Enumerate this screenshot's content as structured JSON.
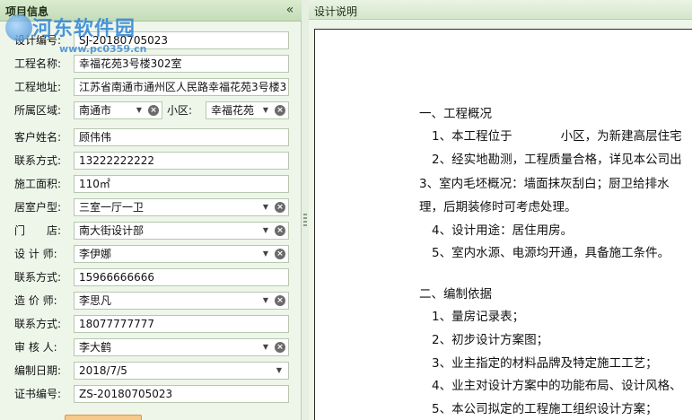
{
  "left_panel": {
    "title": "项目信息",
    "collapse_glyph": "«",
    "fields": [
      {
        "label": "设计编号:",
        "value": "SJ-20180705023",
        "type": "text"
      },
      {
        "label": "工程名称:",
        "value": "幸福花苑3号楼302室",
        "type": "text"
      },
      {
        "label": "工程地址:",
        "value": "江苏省南通市通州区人民路幸福花苑3号楼3",
        "type": "text"
      },
      {
        "label": "所属区域:",
        "value": "南通市",
        "type": "select"
      },
      {
        "label": "客户姓名:",
        "value": "顾伟伟",
        "type": "text"
      },
      {
        "label": "联系方式:",
        "value": "13222222222",
        "type": "text"
      },
      {
        "label": "施工面积:",
        "value": "110㎡",
        "type": "text"
      },
      {
        "label": "居室户型:",
        "value": "三室一厅一卫",
        "type": "select"
      },
      {
        "label": "门　　店:",
        "value": "南大街设计部",
        "type": "select"
      },
      {
        "label": "设 计 师:",
        "value": "李伊娜",
        "type": "select"
      },
      {
        "label": "联系方式:",
        "value": "15966666666",
        "type": "text"
      },
      {
        "label": "造 价 师:",
        "value": "李思凡",
        "type": "select"
      },
      {
        "label": "联系方式:",
        "value": "18077777777",
        "type": "text"
      },
      {
        "label": "审 核 人:",
        "value": "李大鹤",
        "type": "select"
      },
      {
        "label": "编制日期:",
        "value": "2018/7/5",
        "type": "date"
      },
      {
        "label": "证书编号:",
        "value": "ZS-20180705023",
        "type": "text"
      }
    ],
    "subarea_label": "小区:",
    "subarea_value": "幸福花苑"
  },
  "watermark": {
    "text": "河东软件园",
    "url": "www.pc0359.cn"
  },
  "right_panel": {
    "title": "设计说明",
    "doc_lines": [
      "一、工程概况",
      "1、本工程位于　　　　小区，为新建高层住宅",
      "2、经实地勘测，工程质量合格，详见本公司出",
      "3、室内毛坯概况：墙面抹灰刮白；厨卫给排水",
      "理，后期装修时可考虑处理。",
      "4、设计用途：居住用房。",
      "5、室内水源、电源均开通，具备施工条件。",
      "二、编制依据",
      "1、量房记录表；",
      "2、初步设计方案图；",
      "3、业主指定的材料品牌及特定施工工艺；",
      "4、业主对设计方案中的功能布局、设计风格、",
      "5、本公司拟定的工程施工组织设计方案；"
    ]
  },
  "icons": {
    "dropdown": "chevron-down-icon",
    "clear": "clear-x-icon",
    "grip": "splitter-grip-icon",
    "collapse": "collapse-left-icon"
  }
}
